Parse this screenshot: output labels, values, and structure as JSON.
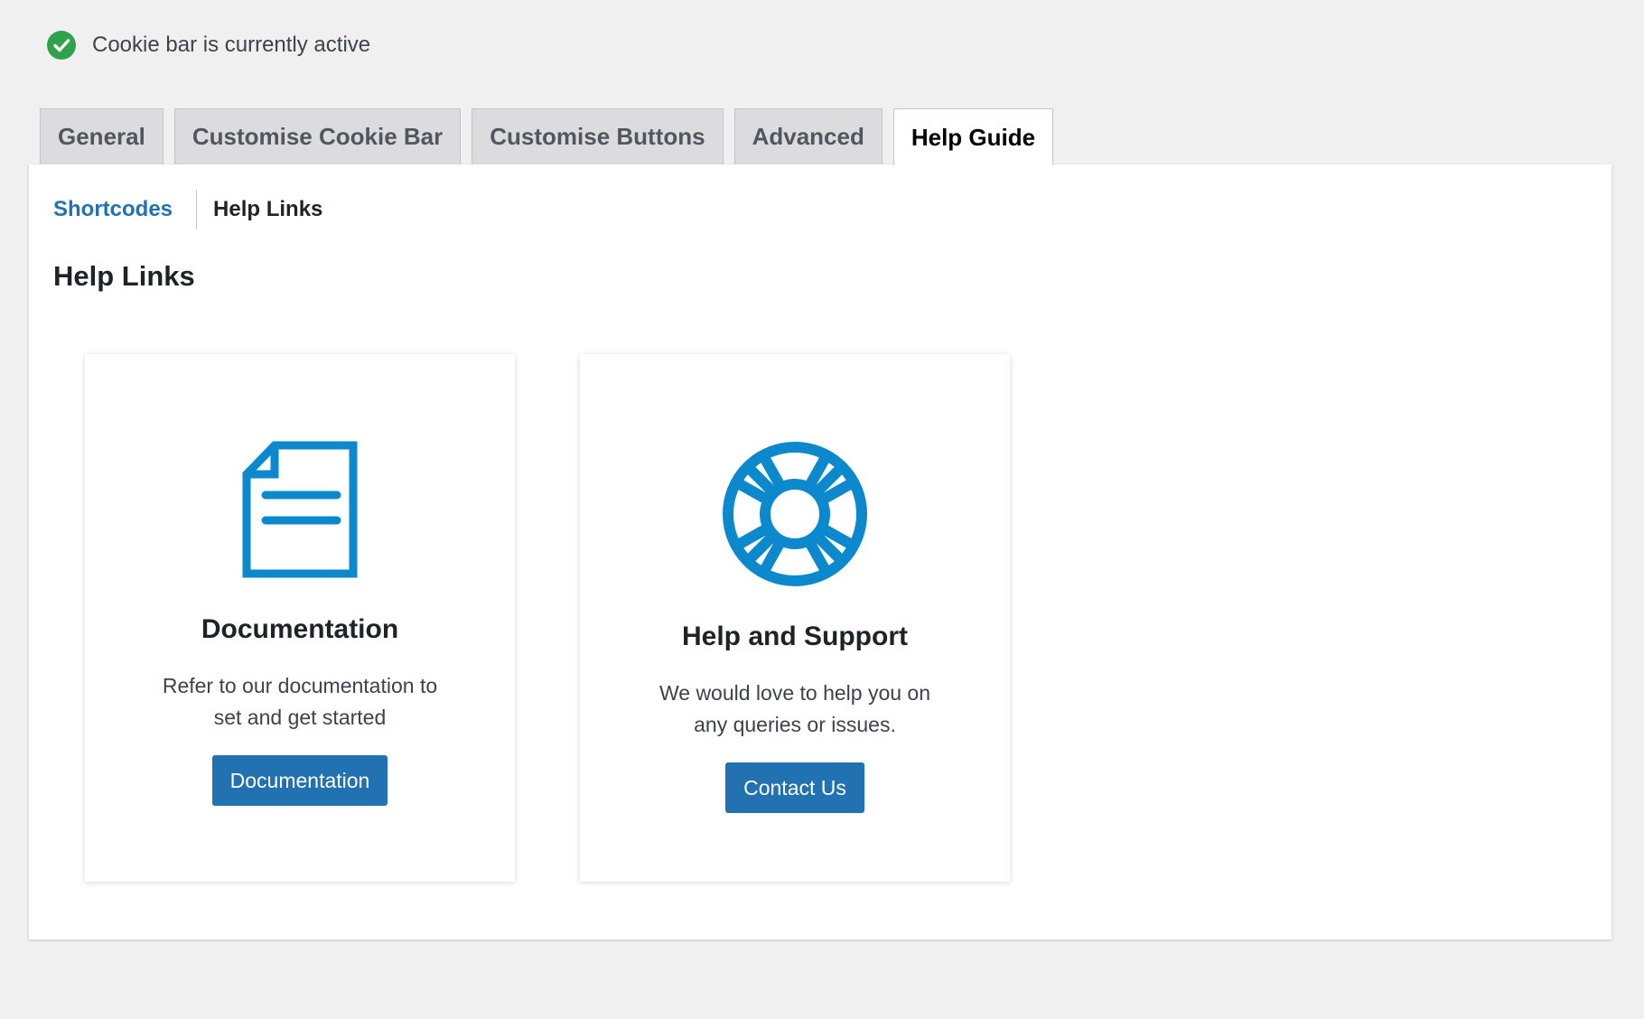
{
  "status": {
    "text": "Cookie bar is currently active",
    "icon": "check-circle-icon",
    "color": "#31a24c"
  },
  "tabs": [
    {
      "label": "General",
      "active": false
    },
    {
      "label": "Customise Cookie Bar",
      "active": false
    },
    {
      "label": "Customise Buttons",
      "active": false
    },
    {
      "label": "Advanced",
      "active": false
    },
    {
      "label": "Help Guide",
      "active": true
    }
  ],
  "subnav": {
    "items": [
      {
        "label": "Shortcodes",
        "active": false
      },
      {
        "label": "Help Links",
        "active": true
      }
    ]
  },
  "section": {
    "title": "Help Links"
  },
  "cards": [
    {
      "icon": "document-icon",
      "title": "Documentation",
      "description": "Refer to our documentation to set and get started",
      "button_label": "Documentation"
    },
    {
      "icon": "lifebuoy-icon",
      "title": "Help and Support",
      "description": "We would love to help you on any queries or issues.",
      "button_label": "Contact Us"
    }
  ],
  "colors": {
    "accent": "#2271b1",
    "icon_blue": "#0c88cc",
    "background": "#f0f0f1",
    "success": "#31a24c"
  }
}
